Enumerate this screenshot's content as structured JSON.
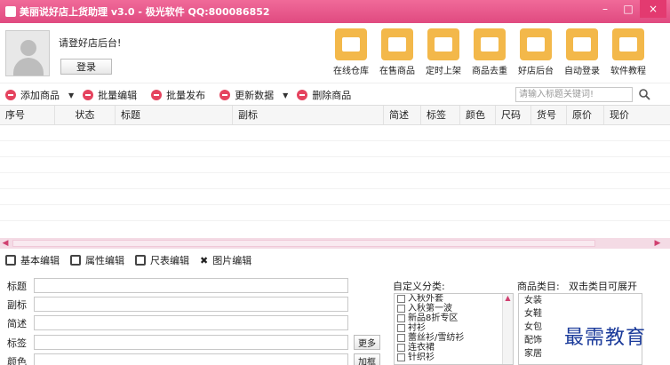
{
  "window": {
    "title": "美丽说好店上货助理 v3.0 - 极光软件 QQ:800086852",
    "min_glyph": "–",
    "max_glyph": "□",
    "close_glyph": "×"
  },
  "user": {
    "prompt": "请登好店后台!",
    "login_label": "登录"
  },
  "tools": [
    {
      "label": "在线仓库",
      "icon": "warehouse-icon",
      "color": "#f3b84a"
    },
    {
      "label": "在售商品",
      "icon": "on-sale-goods-icon",
      "color": "#f3b84a"
    },
    {
      "label": "定时上架",
      "icon": "timer-icon",
      "color": "#f3b84a"
    },
    {
      "label": "商品去重",
      "icon": "dedupe-icon",
      "color": "#f3b84a"
    },
    {
      "label": "好店后台",
      "icon": "store-admin-icon",
      "color": "#f3b84a"
    },
    {
      "label": "自动登录",
      "icon": "auto-login-icon",
      "color": "#f3b84a"
    },
    {
      "label": "软件教程",
      "icon": "tutorial-icon",
      "color": "#f3b84a"
    }
  ],
  "toolbar": {
    "add": "添加商品",
    "batch_edit": "批量编辑",
    "batch_publish": "批量发布",
    "update": "更新数据",
    "delete": "删除商品",
    "search_placeholder": "请输入标题关键词!"
  },
  "table": {
    "columns": [
      "序号",
      "状态",
      "标题",
      "副标",
      "简述",
      "标签",
      "颜色",
      "尺码",
      "货号",
      "原价",
      "现价"
    ]
  },
  "edit_tabs": [
    "基本编辑",
    "属性编辑",
    "尺表编辑",
    "图片编辑"
  ],
  "form": {
    "fields": [
      "标题",
      "副标",
      "简述",
      "标签",
      "颜色"
    ],
    "more_label": "更多",
    "add_frame_label": "加框"
  },
  "custom_categories": {
    "label": "自定义分类:",
    "items": [
      "入秋外套",
      "入秋第一波",
      "新品8折专区",
      "衬衫",
      "蕾丝衫/雪纺衫",
      "连衣裙",
      "针织衫"
    ]
  },
  "product_categories": {
    "label": "商品类目:",
    "hint": "双击类目可展开",
    "items": [
      "女装",
      "女鞋",
      "女包",
      "配饰",
      "家居"
    ]
  },
  "watermark": "最需教育"
}
